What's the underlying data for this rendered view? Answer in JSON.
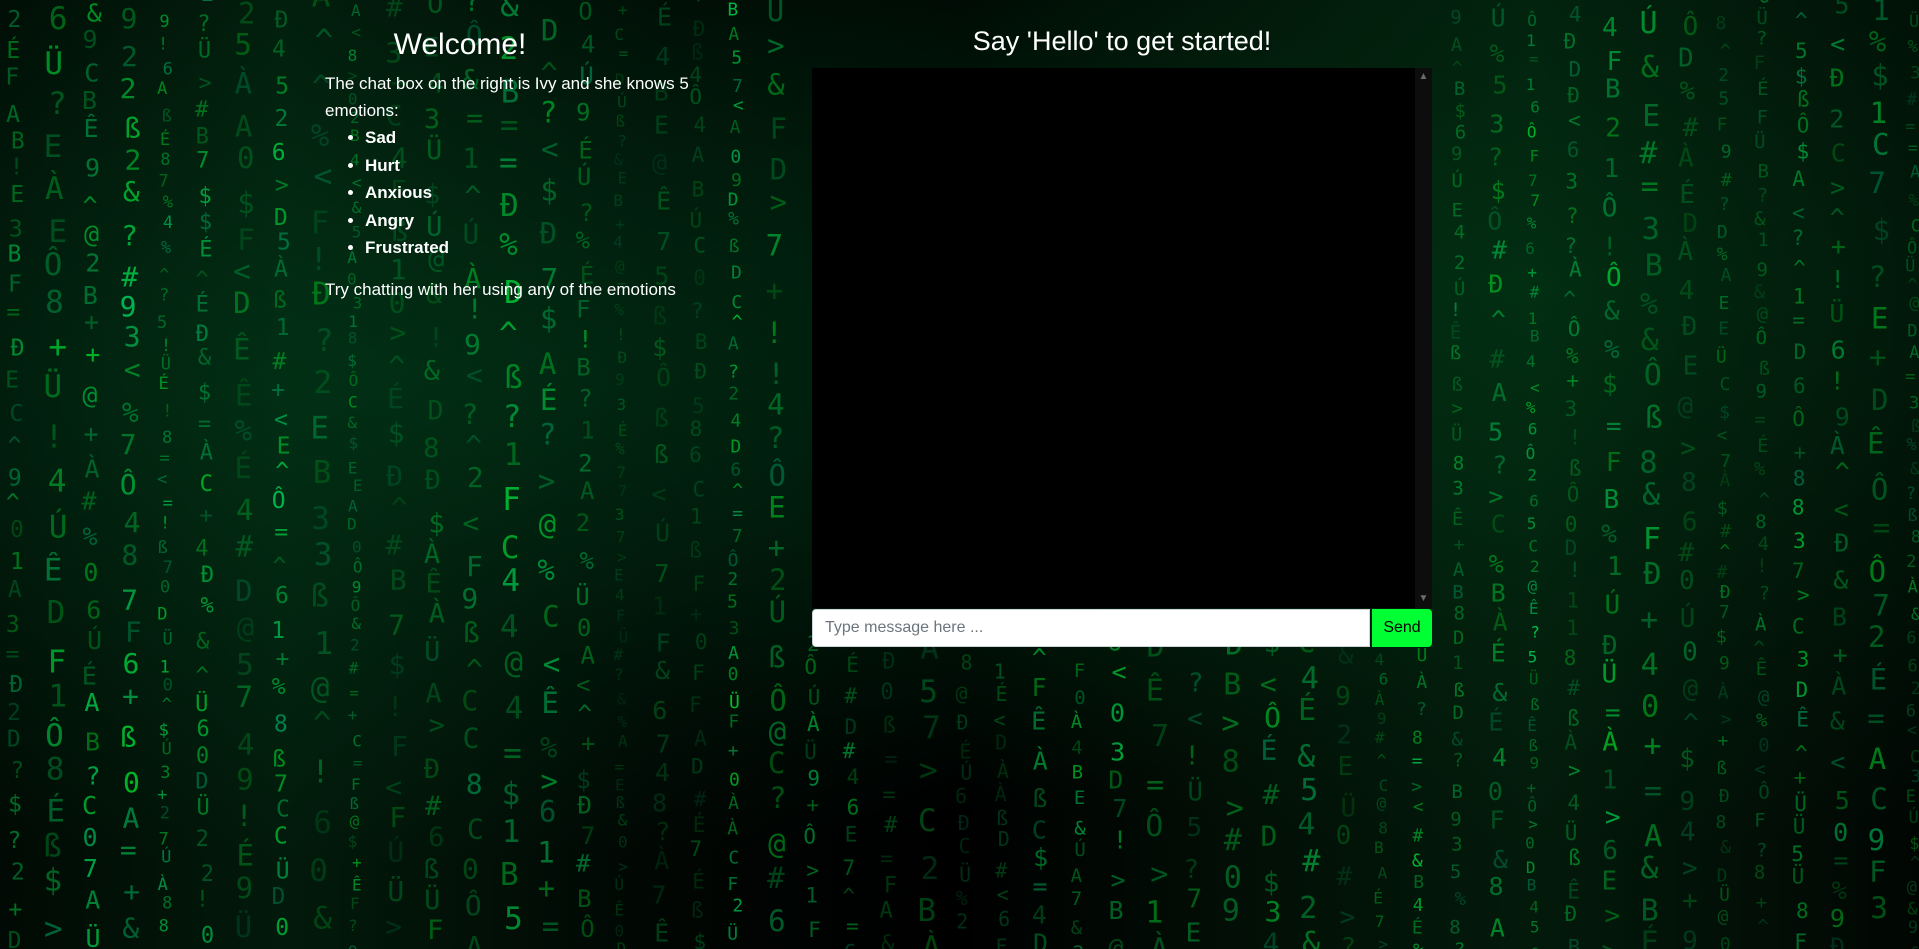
{
  "left_panel": {
    "title": "Welcome!",
    "intro": "The chat box on the right is Ivy and she knows 5 emotions:",
    "emotions": [
      "Sad",
      "Hurt",
      "Anxious",
      "Angry",
      "Frustrated"
    ],
    "outro": "Try chatting with her using any of the emotions"
  },
  "chat": {
    "title": "Say 'Hello' to get started!",
    "input_placeholder": "Type message here ...",
    "send_label": "Send"
  },
  "colors": {
    "send_button": "#00ff33",
    "matrix_green": "#00c853",
    "chat_background": "#000000"
  }
}
